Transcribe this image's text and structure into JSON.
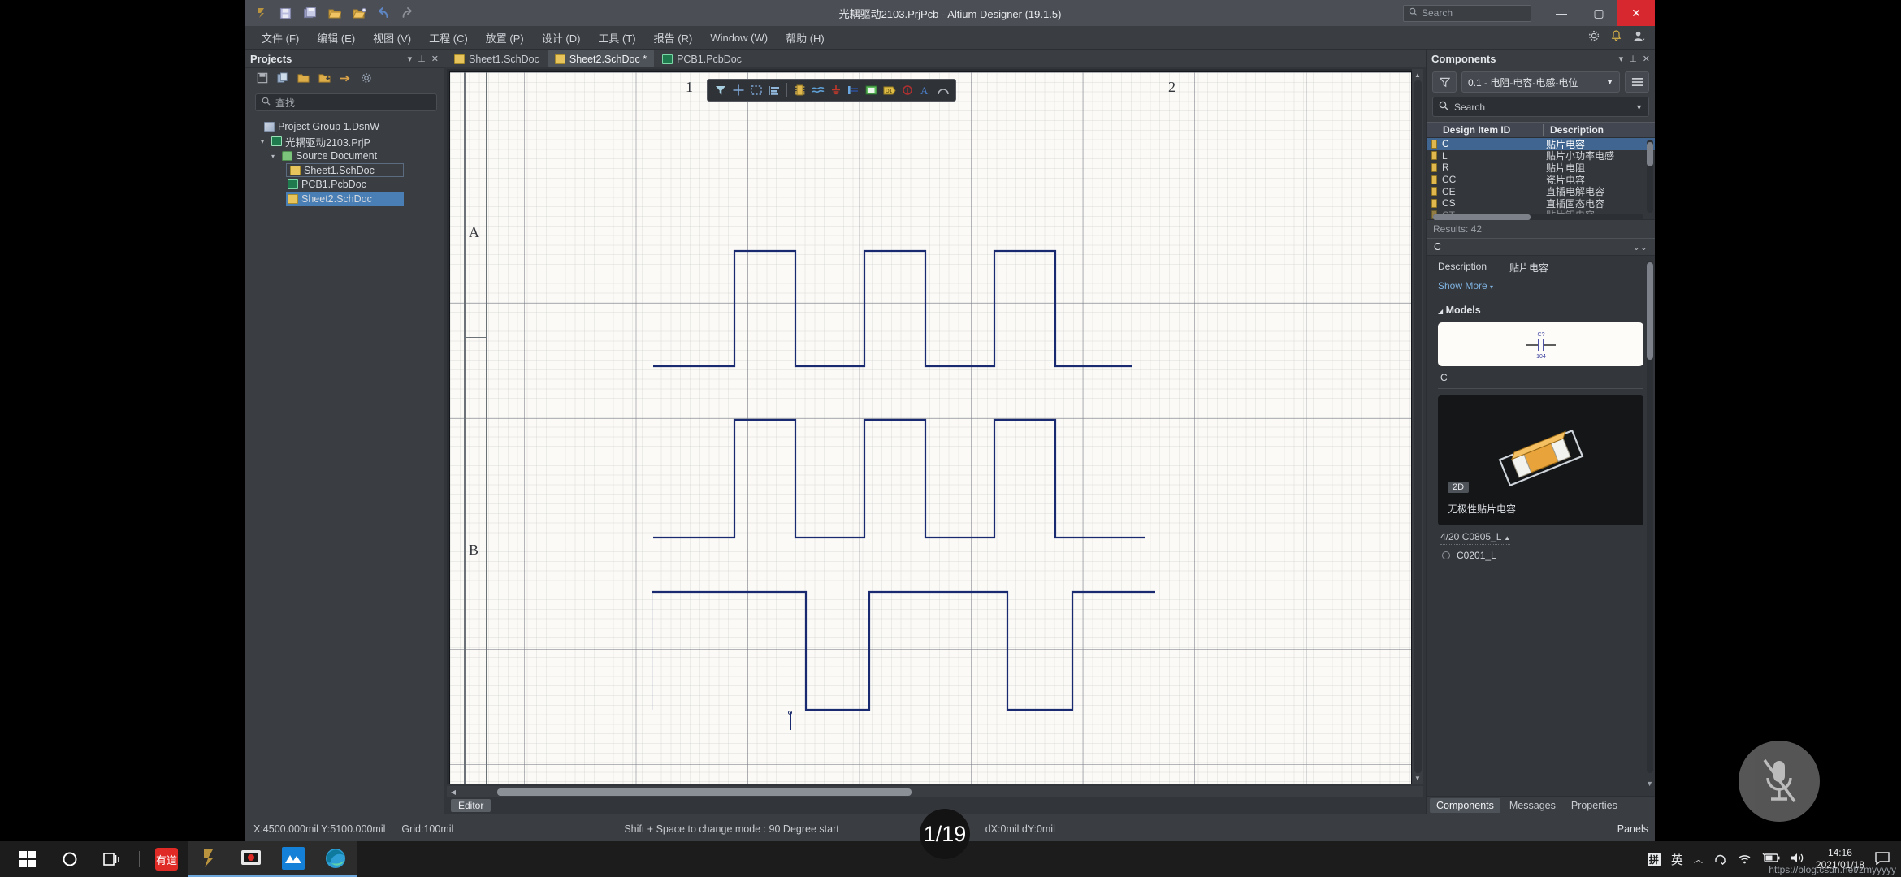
{
  "window": {
    "title": "光耦驱动2103.PrjPcb - Altium Designer (19.1.5)",
    "quick_access": [
      "altium-logo-icon",
      "save-icon",
      "save-all-icon",
      "open-icon",
      "open-project-icon",
      "undo-icon",
      "redo-icon"
    ],
    "search_placeholder": "Search",
    "controls": {
      "minimize": "—",
      "maximize": "▢",
      "close": "✕"
    },
    "right_icons": [
      "gear-icon",
      "bell-icon",
      "user-icon"
    ]
  },
  "menubar": {
    "items": [
      "文件 (F)",
      "编辑 (E)",
      "视图 (V)",
      "工程 (C)",
      "放置 (P)",
      "设计 (D)",
      "工具 (T)",
      "报告 (R)",
      "Window (W)",
      "帮助 (H)"
    ]
  },
  "projects_panel": {
    "title": "Projects",
    "head_buttons": [
      "chevron-down-icon",
      "pin-icon",
      "close-icon"
    ],
    "toolbar_icons": [
      "save-icon",
      "copy-icon",
      "open-folder-icon",
      "add-folder-icon",
      "compile-icon",
      "settings-icon"
    ],
    "search_placeholder": "查找",
    "tree": [
      {
        "label": "Project Group 1.DsnW",
        "icon": "project-group-icon",
        "indent": 0,
        "caret": "",
        "state": ""
      },
      {
        "label": "光耦驱动2103.PrjP",
        "icon": "project-icon",
        "indent": 1,
        "caret": "▾",
        "state": ""
      },
      {
        "label": "Source Document",
        "icon": "folder-icon",
        "indent": 2,
        "caret": "▾",
        "state": ""
      },
      {
        "label": "Sheet1.SchDoc",
        "icon": "schdoc-icon",
        "indent": 3,
        "caret": "",
        "state": "outlined"
      },
      {
        "label": "PCB1.PcbDoc",
        "icon": "pcbdoc-icon",
        "indent": 3,
        "caret": "",
        "state": ""
      },
      {
        "label": "Sheet2.SchDoc",
        "icon": "schdoc-icon",
        "indent": 3,
        "caret": "",
        "state": "selected"
      }
    ]
  },
  "document_tabs": [
    {
      "label": "Sheet1.SchDoc",
      "icon": "schdoc-icon",
      "active": false
    },
    {
      "label": "Sheet2.SchDoc *",
      "icon": "schdoc-icon",
      "active": true
    },
    {
      "label": "PCB1.PcbDoc",
      "icon": "pcbdoc-icon",
      "active": false
    }
  ],
  "schematic": {
    "zone_labels_top": [
      "1",
      "2"
    ],
    "zone_labels_left": [
      "A",
      "B"
    ],
    "wire_color": "#1a2a70",
    "background_color": "#fbfaf6",
    "float_toolbar_icons": [
      "filter-icon",
      "crosshair-icon",
      "select-area-icon",
      "align-icon",
      "component-icon",
      "wire-icon",
      "ground-icon",
      "port-icon",
      "sheet-symbol-icon",
      "net-label-icon",
      "no-erc-icon",
      "text-icon",
      "arc-icon"
    ],
    "editor_button": "Editor"
  },
  "components_panel": {
    "title": "Components",
    "head_buttons": [
      "chevron-down-icon",
      "pin-icon",
      "close-icon"
    ],
    "library_select": "0.1 - 电阻-电容-电感-电位",
    "search_placeholder": "Search",
    "columns": [
      "Design Item ID",
      "Description"
    ],
    "rows": [
      {
        "id": "C",
        "desc": "贴片电容",
        "selected": true
      },
      {
        "id": "L",
        "desc": "贴片小功率电感",
        "selected": false
      },
      {
        "id": "R",
        "desc": "贴片电阻",
        "selected": false
      },
      {
        "id": "CC",
        "desc": "瓷片电容",
        "selected": false
      },
      {
        "id": "CE",
        "desc": "直插电解电容",
        "selected": false
      },
      {
        "id": "CS",
        "desc": "直插固态电容",
        "selected": false
      },
      {
        "id": "CT",
        "desc": "贴片钽电容",
        "selected": false
      }
    ],
    "results": "Results: 42",
    "detail": {
      "header": "C",
      "description_key": "Description",
      "description_value": "贴片电容",
      "show_more": "Show More",
      "models_header": "Models",
      "model_symbol_designator": "C?",
      "model_symbol_value": "104",
      "model_name": "C",
      "preview_badge": "2D",
      "preview_caption": "无极性贴片电容",
      "footprint_counter": "4/20  C0805_L",
      "footprint_item": "C0201_L"
    },
    "tabs": [
      {
        "label": "Components",
        "active": true
      },
      {
        "label": "Messages",
        "active": false
      },
      {
        "label": "Properties",
        "active": false
      }
    ]
  },
  "statusbar": {
    "coords": "X:4500.000mil Y:5100.000mil",
    "grid": "Grid:100mil",
    "hint": "Shift + Space to change mode : 90 Degree start",
    "delta": "dX:0mil dY:0mil",
    "panels_button": "Panels"
  },
  "overlay": {
    "page_indicator": "1/19",
    "mic_icon": "microphone-muted-icon",
    "watermark": "https://blog.csdn.net/zmyyyyy"
  },
  "taskbar": {
    "items": [
      {
        "name": "start-button",
        "icon": "windows-icon"
      },
      {
        "name": "cortana-search",
        "icon": "circle-icon"
      },
      {
        "name": "task-view",
        "icon": "task-view-icon"
      },
      {
        "name": "youdao-dict",
        "icon": "youdao-icon",
        "label": "有道"
      },
      {
        "name": "altium-designer",
        "icon": "altium-icon"
      },
      {
        "name": "screen-recorder",
        "icon": "recorder-icon"
      },
      {
        "name": "app-blue",
        "icon": "mountain-icon"
      },
      {
        "name": "edge-browser",
        "icon": "edge-icon"
      }
    ],
    "tray": {
      "ime_pin": "拼",
      "ime_lang": "英",
      "icons": [
        "chevron-up-icon",
        "headset-icon",
        "wifi-icon",
        "battery-icon",
        "volume-icon"
      ],
      "time": "14:16",
      "date": "2021/01/18",
      "action_center": "notification-icon"
    }
  }
}
